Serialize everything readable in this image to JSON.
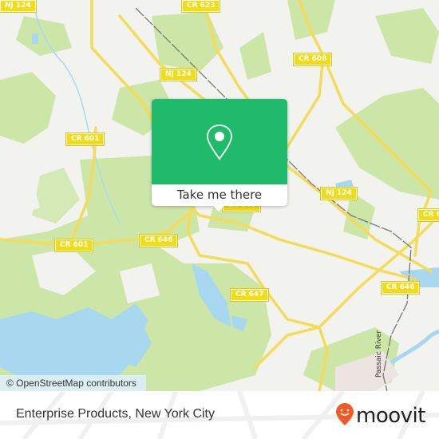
{
  "map": {
    "colors": {
      "background": "#f2f2ee",
      "park": "#cce6a8",
      "water": "#a8d8f0",
      "road": "#f2dc5a",
      "rail": "#777777",
      "industrial": "#ece4e0"
    },
    "road_shields": [
      {
        "label": "NJ 124"
      },
      {
        "label": "CR 623"
      },
      {
        "label": "CR 608"
      },
      {
        "label": "NJ 124"
      },
      {
        "label": "CR 601"
      },
      {
        "label": "NJ 124"
      },
      {
        "label": "CR 6"
      },
      {
        "label": "CR 601"
      },
      {
        "label": "CR 646"
      },
      {
        "label": "CR 646"
      },
      {
        "label": "CR 647"
      },
      {
        "label": "CR 646"
      }
    ],
    "river_label": "Passaic River",
    "attribution": "© OpenStreetMap contributors"
  },
  "popup": {
    "icon": "location-pin-icon",
    "button_label": "Take me there",
    "accent_color": "#1fbb6b"
  },
  "footer": {
    "place_title": "Enterprise Products, New York City",
    "brand": {
      "icon": "moovit-pin-icon",
      "name": "moovit",
      "color": "#f05a28"
    }
  }
}
